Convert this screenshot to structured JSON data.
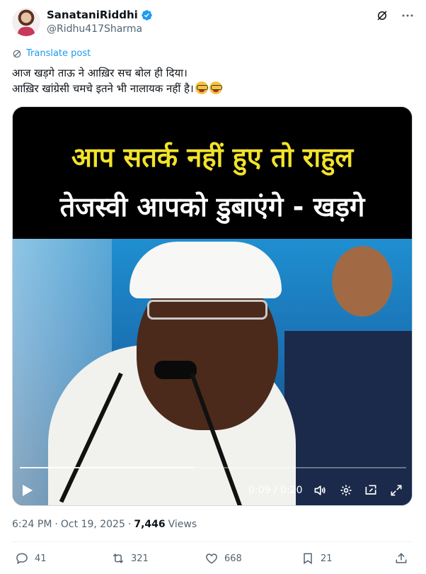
{
  "author": {
    "display_name": "SanataniRiddhi",
    "handle": "@Ridhu417Sharma",
    "verified": true,
    "avatar_icon": "avatar-image"
  },
  "translate_label": "Translate post",
  "tweet_text": {
    "line1": "आज खड़गे ताऊ ने आख़िर सच बोल ही दिया।",
    "line2": "आख़िर खांग्रेसी चमचे इतने भी नालायक नहीं है।",
    "emojis": [
      "nerd-face-emoji",
      "nerd-face-emoji"
    ]
  },
  "video": {
    "headline_line1": "आप सतर्क नहीं हुए तो राहुल",
    "headline_line2": "तेजस्वी आपको डुबाएंगे - खड़गे",
    "time_display": "0:09 / 0:20",
    "current_seconds": 9,
    "duration_seconds": 20,
    "progress_fraction": 0.45,
    "headline1_color": "#f2e32b",
    "headline2_color": "#ffffff"
  },
  "meta": {
    "time": "6:24 PM",
    "separator": "·",
    "date": "Oct 19, 2025",
    "views_count": "7,446",
    "views_label": "Views"
  },
  "actions": {
    "replies": "41",
    "reposts": "321",
    "likes": "668",
    "bookmarks": "21"
  },
  "colors": {
    "accent": "#1d9bf0",
    "text_secondary": "#536471",
    "text_primary": "#0f1419"
  }
}
